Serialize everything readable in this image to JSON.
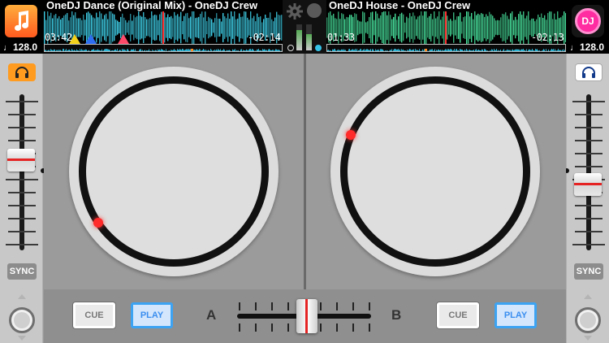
{
  "deck_a": {
    "track_title": "OneDJ Dance (Original Mix) - OneDJ Crew",
    "elapsed": "03:42",
    "remaining": "-02:14",
    "bpm": "128.0",
    "wave_color": "#40d3ec",
    "headphone_active": true,
    "transport": {
      "cue_label": "CUE",
      "play_label": "PLAY"
    },
    "sync_label": "SYNC",
    "pitch_level": 0.42
  },
  "deck_b": {
    "track_title": "OneDJ House - OneDJ Crew",
    "elapsed": "01:33",
    "remaining": "-02:13",
    "bpm": "128.0",
    "wave_color": "#49e6a0",
    "headphone_active": false,
    "transport": {
      "cue_label": "CUE",
      "play_label": "PLAY"
    },
    "sync_label": "SYNC",
    "pitch_level": 0.58
  },
  "top": {
    "dj_label": "DJ",
    "music_icon": "music-note-icon",
    "settings_icon": "gear-icon"
  },
  "crossfader": {
    "left_label": "A",
    "right_label": "B",
    "position": 0.52
  },
  "colors": {
    "accent_orange": "#ff9b1f",
    "play_blue": "#3ca3f3",
    "marker_red": "#ff2a2a",
    "dj_pink": "#ff2ba0"
  }
}
